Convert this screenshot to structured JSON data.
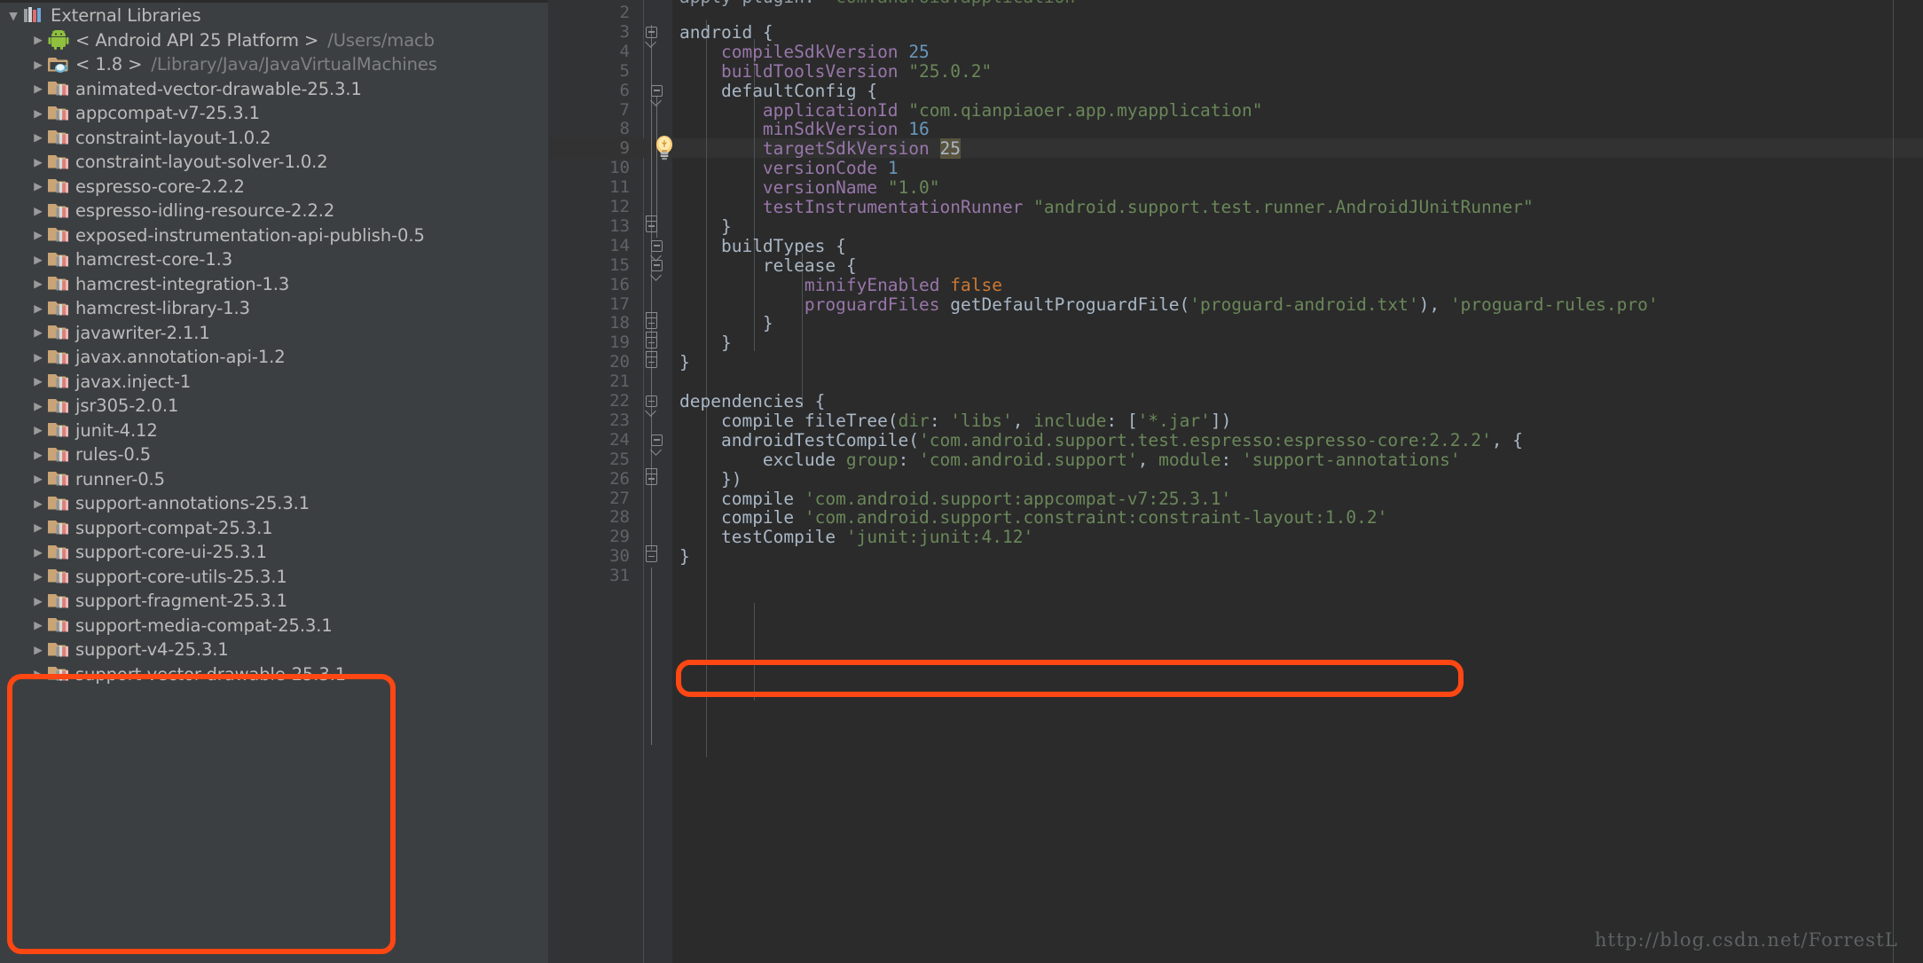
{
  "sidebar": {
    "root": {
      "label": "External Libraries",
      "icon": "books-icon",
      "expanded": true,
      "twisty": "▼"
    },
    "items": [
      {
        "label": "< Android API 25 Platform >",
        "path": "/Users/macb",
        "icon": "android-icon",
        "twisty": "▶"
      },
      {
        "label": "< 1.8 >",
        "path": "/Library/Java/JavaVirtualMachines",
        "icon": "jdk-icon",
        "twisty": "▶"
      },
      {
        "label": "animated-vector-drawable-25.3.1",
        "path": "",
        "icon": "library-icon",
        "twisty": "▶"
      },
      {
        "label": "appcompat-v7-25.3.1",
        "path": "",
        "icon": "library-icon",
        "twisty": "▶"
      },
      {
        "label": "constraint-layout-1.0.2",
        "path": "",
        "icon": "library-icon",
        "twisty": "▶"
      },
      {
        "label": "constraint-layout-solver-1.0.2",
        "path": "",
        "icon": "library-icon",
        "twisty": "▶"
      },
      {
        "label": "espresso-core-2.2.2",
        "path": "",
        "icon": "library-icon",
        "twisty": "▶"
      },
      {
        "label": "espresso-idling-resource-2.2.2",
        "path": "",
        "icon": "library-icon",
        "twisty": "▶"
      },
      {
        "label": "exposed-instrumentation-api-publish-0.5",
        "path": "",
        "icon": "library-icon",
        "twisty": "▶"
      },
      {
        "label": "hamcrest-core-1.3",
        "path": "",
        "icon": "library-icon",
        "twisty": "▶"
      },
      {
        "label": "hamcrest-integration-1.3",
        "path": "",
        "icon": "library-icon",
        "twisty": "▶"
      },
      {
        "label": "hamcrest-library-1.3",
        "path": "",
        "icon": "library-icon",
        "twisty": "▶"
      },
      {
        "label": "javawriter-2.1.1",
        "path": "",
        "icon": "library-icon",
        "twisty": "▶"
      },
      {
        "label": "javax.annotation-api-1.2",
        "path": "",
        "icon": "library-icon",
        "twisty": "▶"
      },
      {
        "label": "javax.inject-1",
        "path": "",
        "icon": "library-icon",
        "twisty": "▶"
      },
      {
        "label": "jsr305-2.0.1",
        "path": "",
        "icon": "library-icon",
        "twisty": "▶"
      },
      {
        "label": "junit-4.12",
        "path": "",
        "icon": "library-icon",
        "twisty": "▶"
      },
      {
        "label": "rules-0.5",
        "path": "",
        "icon": "library-icon",
        "twisty": "▶"
      },
      {
        "label": "runner-0.5",
        "path": "",
        "icon": "library-icon",
        "twisty": "▶"
      },
      {
        "label": "support-annotations-25.3.1",
        "path": "",
        "icon": "library-icon",
        "twisty": "▶"
      },
      {
        "label": "support-compat-25.3.1",
        "path": "",
        "icon": "library-icon",
        "twisty": "▶"
      },
      {
        "label": "support-core-ui-25.3.1",
        "path": "",
        "icon": "library-icon",
        "twisty": "▶"
      },
      {
        "label": "support-core-utils-25.3.1",
        "path": "",
        "icon": "library-icon",
        "twisty": "▶"
      },
      {
        "label": "support-fragment-25.3.1",
        "path": "",
        "icon": "library-icon",
        "twisty": "▶"
      },
      {
        "label": "support-media-compat-25.3.1",
        "path": "",
        "icon": "library-icon",
        "twisty": "▶"
      },
      {
        "label": "support-v4-25.3.1",
        "path": "",
        "icon": "library-icon",
        "twisty": "▶"
      },
      {
        "label": "support-vector-drawable-25.3.1",
        "path": "",
        "icon": "library-icon",
        "twisty": "▶"
      }
    ]
  },
  "editor": {
    "language": "gradle",
    "current_line": 9,
    "intention_icon": "lightbulb-icon",
    "lines": [
      {
        "n": 2,
        "text": ""
      },
      {
        "n": 3,
        "text": "android {"
      },
      {
        "n": 4,
        "text": "    compileSdkVersion 25"
      },
      {
        "n": 5,
        "text": "    buildToolsVersion \"25.0.2\""
      },
      {
        "n": 6,
        "text": "    defaultConfig {"
      },
      {
        "n": 7,
        "text": "        applicationId \"com.qianpiaoer.app.myapplication\""
      },
      {
        "n": 8,
        "text": "        minSdkVersion 16"
      },
      {
        "n": 9,
        "text": "        targetSdkVersion 25"
      },
      {
        "n": 10,
        "text": "        versionCode 1"
      },
      {
        "n": 11,
        "text": "        versionName \"1.0\""
      },
      {
        "n": 12,
        "text": "        testInstrumentationRunner \"android.support.test.runner.AndroidJUnitRunner\""
      },
      {
        "n": 13,
        "text": "    }"
      },
      {
        "n": 14,
        "text": "    buildTypes {"
      },
      {
        "n": 15,
        "text": "        release {"
      },
      {
        "n": 16,
        "text": "            minifyEnabled false"
      },
      {
        "n": 17,
        "text": "            proguardFiles getDefaultProguardFile('proguard-android.txt'), 'proguard-rules.pro'"
      },
      {
        "n": 18,
        "text": "        }"
      },
      {
        "n": 19,
        "text": "    }"
      },
      {
        "n": 20,
        "text": "}"
      },
      {
        "n": 21,
        "text": ""
      },
      {
        "n": 22,
        "text": "dependencies {"
      },
      {
        "n": 23,
        "text": "    compile fileTree(dir: 'libs', include: ['*.jar'])"
      },
      {
        "n": 24,
        "text": "    androidTestCompile('com.android.support.test.espresso:espresso-core:2.2.2', {"
      },
      {
        "n": 25,
        "text": "        exclude group: 'com.android.support', module: 'support-annotations'"
      },
      {
        "n": 26,
        "text": "    })"
      },
      {
        "n": 27,
        "text": "    compile 'com.android.support:appcompat-v7:25.3.1'"
      },
      {
        "n": 28,
        "text": "    compile 'com.android.support.constraint:constraint-layout:1.0.2'"
      },
      {
        "n": 29,
        "text": "    testCompile 'junit:junit:4.12'"
      },
      {
        "n": 30,
        "text": "}"
      },
      {
        "n": 31,
        "text": ""
      }
    ]
  },
  "annotations": {
    "accent_color": "#ff4713",
    "boxes": [
      {
        "name": "support-libraries-highlight",
        "target": "sidebar support-* entries"
      },
      {
        "name": "appcompat-dependency-highlight",
        "target": "line 27 compile appcompat-v7"
      }
    ]
  },
  "watermark": {
    "text": "http://blog.csdn.net/ForrestL"
  },
  "theme": {
    "sidebar_bg": "#3c3f41",
    "editor_bg": "#2b2b2b",
    "gutter_bg": "#313335",
    "text": "#a9b7c6",
    "line_number": "#606366",
    "string": "#6a8759",
    "number": "#6897bb",
    "attribute": "#9876aa",
    "keyword": "#cc7832",
    "current_line_bg": "#323232",
    "highlight_bg": "#59533e"
  }
}
